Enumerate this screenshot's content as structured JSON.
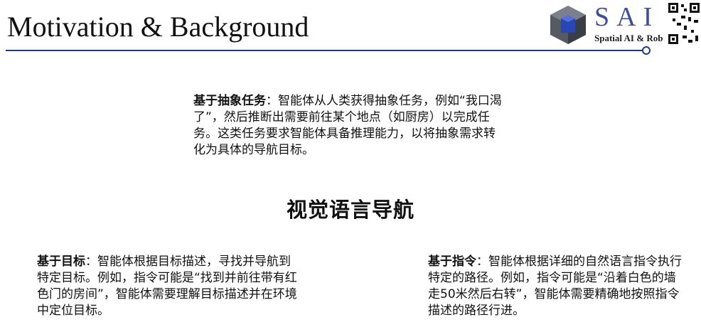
{
  "slide": {
    "title": "Motivation & Background",
    "logo": {
      "letters": "SAI",
      "subtitle": "Spatial AI & Rob"
    },
    "center_title": "视觉语言导航",
    "abstract_task": {
      "label": "基于抽象任务",
      "text": "：智能体从人类获得抽象任务，例如“我口渴了”，然后推断出需要前往某个地点（如厨房）以完成任务。这类任务要求智能体具备推理能力，以将抽象需求转化为具体的导航目标。"
    },
    "goal_based": {
      "label": "基于目标",
      "text": "：智能体根据目标描述，寻找并导航到特定目标。例如，指令可能是“找到并前往带有红色门的房间”，智能体需要理解目标描述并在环境中定位目标。"
    },
    "instruction_based": {
      "label": "基于指令",
      "text": "：智能体根据详细的自然语言指令执行特定的路径。例如，指令可能是“沿着白色的墙走50米然后右转”，智能体需要精确地按照指令描述的路径行进。"
    },
    "colors": {
      "rule": "#1f3a8a",
      "logo_text": "#3d4fa0"
    },
    "icons": [
      "logo-cube-icon",
      "qr-code-icon"
    ]
  }
}
